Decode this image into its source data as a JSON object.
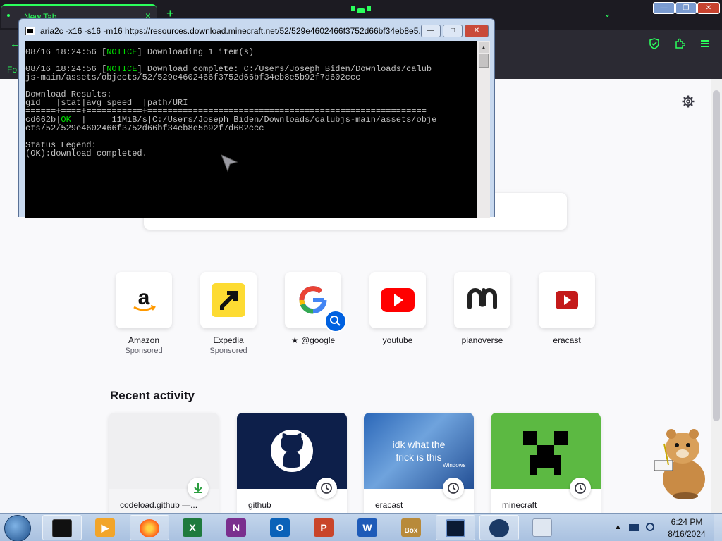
{
  "browser": {
    "tab_title": "New Tab",
    "tab_close": "×",
    "new_tab": "+",
    "chevron": "⌄",
    "bookmark_label": "Fo",
    "nav_back": "←",
    "toolbar_icons": [
      "shield-icon",
      "extensions-icon",
      "menu-icon"
    ],
    "window_controls": {
      "minimize": "—",
      "maximize": "❐",
      "close": "✕"
    },
    "accent_color": "#2bff5c"
  },
  "console": {
    "title": "aria2c  -x16 -s16 -m16 https://resources.download.minecraft.net/52/529e4602466f3752d66bf34eb8e5...",
    "controls": {
      "minimize": "—",
      "maximize": "□",
      "close": "✕"
    },
    "lines": {
      "l1a": "08/16 18:24:56 [",
      "l1b": "NOTICE",
      "l1c": "] Downloading 1 item(s)",
      "l2a": "08/16 18:24:56 [",
      "l2b": "NOTICE",
      "l2c": "] Download complete: C:/Users/Joseph Biden/Downloads/calub",
      "l3": "js-main/assets/objects/52/529e4602466f3752d66bf34eb8e5b92f7d602ccc",
      "l4": "Download Results:",
      "l5": "gid   |stat|avg speed  |path/URI",
      "l6": "======+====+===========+=======================================================",
      "l7a": "cd662b|",
      "l7b": "OK",
      "l7c": "  |     11MiB/s|C:/Users/Joseph Biden/Downloads/calubjs-main/assets/obje",
      "l8": "cts/52/529e4602466f3752d66bf34eb8e5b92f7d602ccc",
      "l9": "Status Legend:",
      "l10": "(OK):download completed."
    }
  },
  "newtab": {
    "settings_icon": "gear-icon",
    "shortcuts": [
      {
        "name": "Amazon",
        "sponsored": "Sponsored"
      },
      {
        "name": "Expedia",
        "sponsored": "Sponsored"
      },
      {
        "name": "@google",
        "prefix": "★",
        "sponsored": ""
      },
      {
        "name": "youtube",
        "sponsored": ""
      },
      {
        "name": "pianoverse",
        "sponsored": ""
      },
      {
        "name": "eracast",
        "sponsored": ""
      }
    ],
    "recent_title": "Recent activity",
    "recent": [
      {
        "caption": "codeload.github —...",
        "badge": "download-icon"
      },
      {
        "caption": "github",
        "badge": "clock-icon"
      },
      {
        "caption": "eracast",
        "badge": "clock-icon",
        "image_text": "idk what the frick is this",
        "image_subtext": "Windows"
      },
      {
        "caption": "minecraft",
        "badge": "clock-icon"
      }
    ]
  },
  "taskbar": {
    "time": "6:24 PM",
    "date": "8/16/2024",
    "tray_arrow": "▲",
    "apps": [
      "start-orb",
      "terminal",
      "media-player",
      "firefox",
      "excel",
      "onenote",
      "outlook",
      "powerpoint",
      "word",
      "box-app",
      "console-window",
      "steam",
      "explorer"
    ],
    "app_letters": {
      "excel": "X",
      "onenote": "N",
      "outlook": "O",
      "powerpoint": "P",
      "word": "W",
      "box": "Box"
    }
  }
}
